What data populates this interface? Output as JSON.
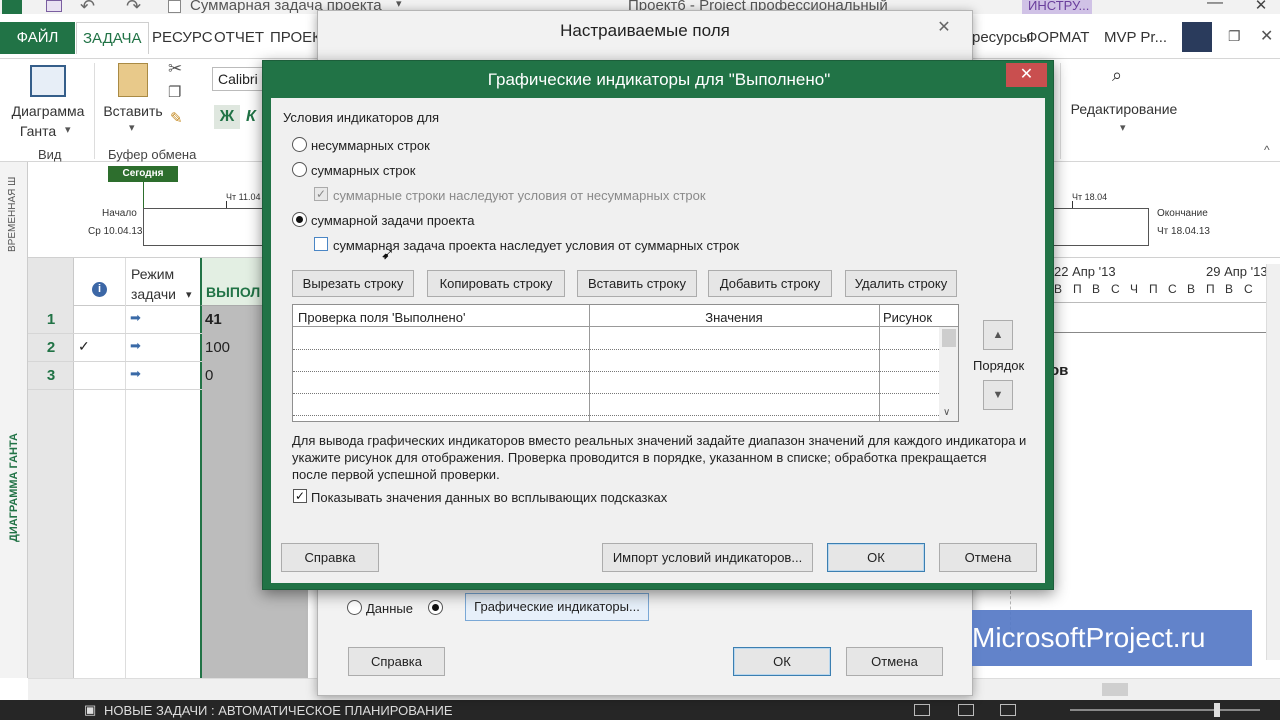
{
  "window": {
    "doc_title": "Суммарная задача проекта",
    "app_title": "Проект6 - Project профессиональный",
    "tools_label": "ИНСТРУ...",
    "extra_tabs": [
      "ресурсы",
      "ФОРМАТ",
      "MVP Pr..."
    ]
  },
  "ribbon": {
    "tabs": [
      "ФАЙЛ",
      "ЗАДАЧА",
      "РЕСУРС",
      "ОТЧЕТ",
      "ПРОЕК"
    ],
    "gantt_btn": [
      "Диаграмма",
      "Ганта"
    ],
    "paste_btn": "Вставить",
    "font_name": "Calibri",
    "bold": "Ж",
    "italic": "К",
    "group_view": "Вид",
    "group_clipboard": "Буфер обмена",
    "editing": "Редактирование"
  },
  "timeline": {
    "side_label": "ВРЕМЕННАЯ Ш",
    "today": "Сегодня",
    "start_label": "Начало",
    "start_date": "Ср 10.04.13",
    "date1": "Чт 11.04",
    "date2": "Чт 18.04",
    "end_label": "Окончание",
    "end_date": "Чт 18.04.13"
  },
  "grid": {
    "side_label": "ДИАГРАММА ГАНТА",
    "col_info": "i",
    "col_mode": [
      "Режим",
      "задачи"
    ],
    "col_done": "ВЫПОЛ",
    "rows": [
      {
        "num": "1",
        "check": "",
        "value": "41"
      },
      {
        "num": "2",
        "check": "✓",
        "value": "100"
      },
      {
        "num": "3",
        "check": "",
        "value": "0"
      }
    ],
    "week1": "22 Апр '13",
    "week2": "29 Апр '13",
    "days": [
      "В",
      "П",
      "В",
      "С",
      "Ч",
      "П",
      "С",
      "В",
      "П",
      "В",
      "С"
    ],
    "partial_text": "ов"
  },
  "statusbar": {
    "text": "НОВЫЕ ЗАДАЧИ : АВТОМАТИЧЕСКОЕ ПЛАНИРОВАНИЕ"
  },
  "watermark": "MicrosoftProject.ru",
  "back_dialog": {
    "title": "Настраиваемые поля",
    "radio_data": "Данные",
    "indicators_btn": "Графические индикаторы...",
    "help_btn": "Справка",
    "ok_btn": "ОК",
    "cancel_btn": "Отмена"
  },
  "dialog": {
    "title": "Графические индикаторы для \"Выполнено\"",
    "group_label": "Условия индикаторов для",
    "opt_nonsummary": "несуммарных строк",
    "opt_summary": "суммарных строк",
    "chk_summary_inherit": "суммарные строки наследуют условия от несуммарных строк",
    "opt_project_summary": "суммарной задачи проекта",
    "chk_project_inherit": "суммарная задача проекта наследует условия от суммарных строк",
    "buttons": {
      "cut": "Вырезать строку",
      "copy": "Копировать строку",
      "paste": "Вставить строку",
      "add": "Добавить строку",
      "delete": "Удалить строку"
    },
    "table_headers": [
      "Проверка поля 'Выполнено'",
      "Значения",
      "Рисунок"
    ],
    "order_label": "Порядок",
    "description_lines": [
      "Для вывода графических индикаторов вместо реальных значений задайте диапазон значений для каждого индикатора и",
      "укажите рисунок для отображения.  Проверка проводится в порядке, указанном в списке; обработка прекращается",
      "после первой успешной проверки."
    ],
    "chk_tooltips": "Показывать значения данных во всплывающих подсказках",
    "help_btn": "Справка",
    "import_btn": "Импорт условий индикаторов...",
    "ok_btn": "ОК",
    "cancel_btn": "Отмена"
  }
}
